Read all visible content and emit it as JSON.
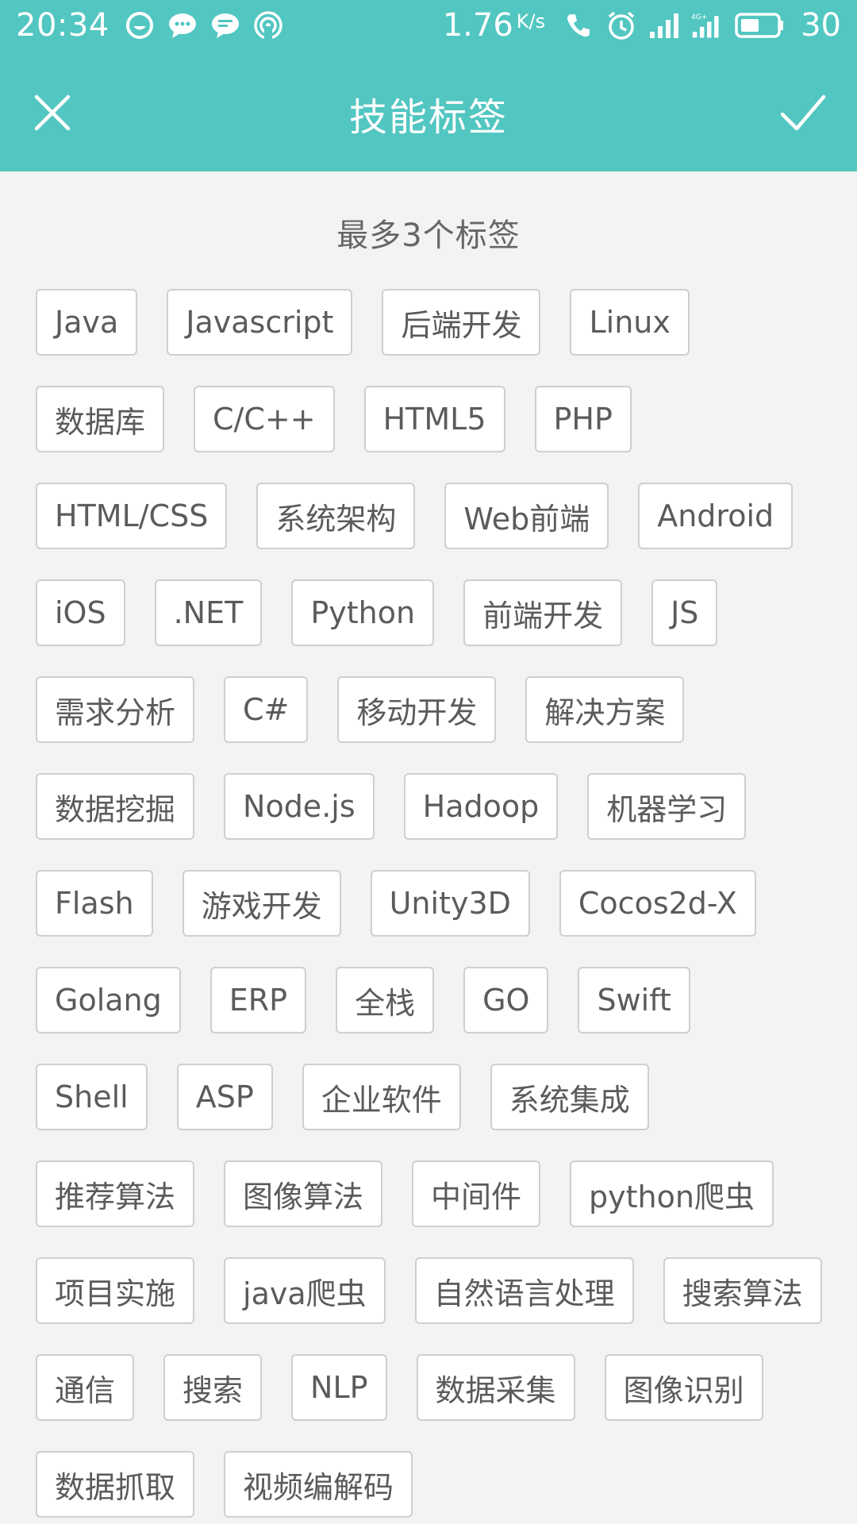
{
  "status_bar": {
    "time": "20:34",
    "network_speed": "1.76",
    "network_speed_unit": "K/s",
    "battery_level": "30",
    "left_icons": [
      "face-icon",
      "chat-bubble-icon",
      "message-icon",
      "broadcast-icon"
    ],
    "right_icons": [
      "call-icon",
      "alarm-icon",
      "signal-icon",
      "4g-signal-icon",
      "battery-icon"
    ]
  },
  "toolbar": {
    "title": "技能标签",
    "close_icon": "close-icon",
    "confirm_icon": "check-icon",
    "background_color": "#52c6c1"
  },
  "hint": "最多3个标签",
  "tags": [
    "Java",
    "Javascript",
    "后端开发",
    "Linux",
    "数据库",
    "C/C++",
    "HTML5",
    "PHP",
    "HTML/CSS",
    "系统架构",
    "Web前端",
    "Android",
    "iOS",
    ".NET",
    "Python",
    "前端开发",
    "JS",
    "需求分析",
    "C#",
    "移动开发",
    "解决方案",
    "数据挖掘",
    "Node.js",
    "Hadoop",
    "机器学习",
    "Flash",
    "游戏开发",
    "Unity3D",
    "Cocos2d-X",
    "Golang",
    "ERP",
    "全栈",
    "GO",
    "Swift",
    "Shell",
    "ASP",
    "企业软件",
    "系统集成",
    "推荐算法",
    "图像算法",
    "中间件",
    "python爬虫",
    "项目实施",
    "java爬虫",
    "自然语言处理",
    "搜索算法",
    "通信",
    "搜索",
    "NLP",
    "数据采集",
    "图像识别",
    "数据抓取",
    "视频编解码"
  ]
}
